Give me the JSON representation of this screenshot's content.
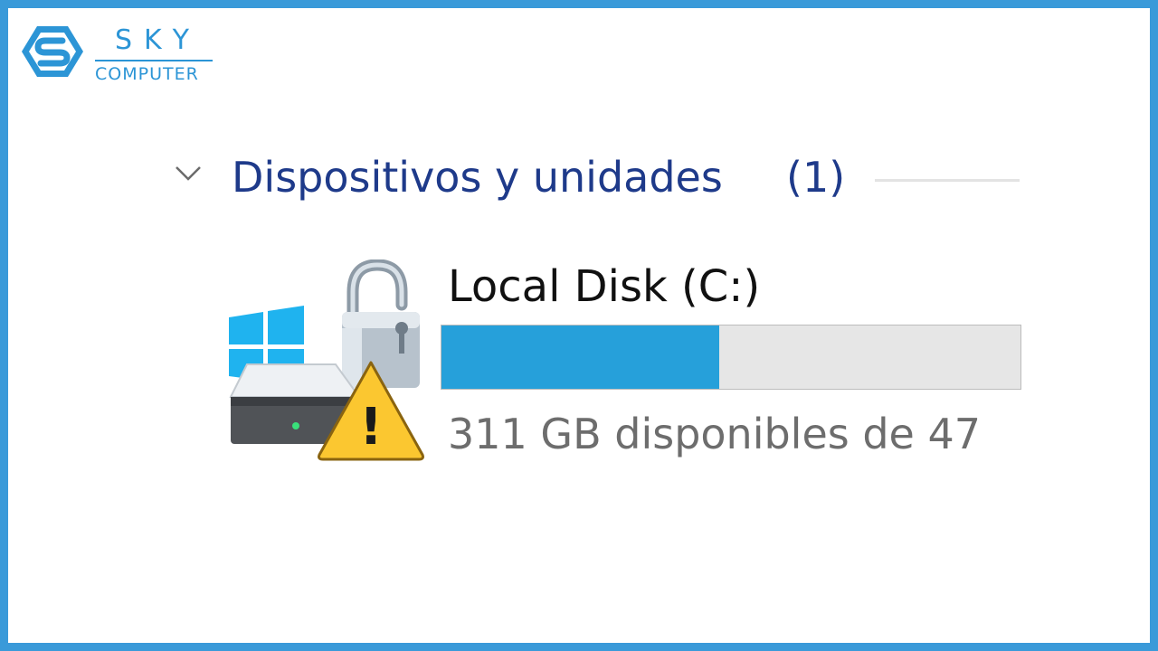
{
  "brand": {
    "name": "SKY",
    "subtitle": "COMPUTER",
    "color": "#2c95d6"
  },
  "frame": {
    "border_color": "#3a9ad9"
  },
  "section": {
    "title": "Dispositivos y unidades",
    "count": "(1)",
    "expanded": true,
    "chevron_icon": "chevron-down-icon"
  },
  "drive": {
    "name": "Local Disk (C:)",
    "free_text": "311 GB disponibles de 47",
    "used_fraction": 0.48,
    "bar_fill_color": "#26a0da",
    "bar_track_color": "#e6e6e6",
    "icons": [
      "windows-logo-icon",
      "hard-drive-icon",
      "padlock-open-icon",
      "warning-icon"
    ],
    "warning_symbol": "!"
  }
}
